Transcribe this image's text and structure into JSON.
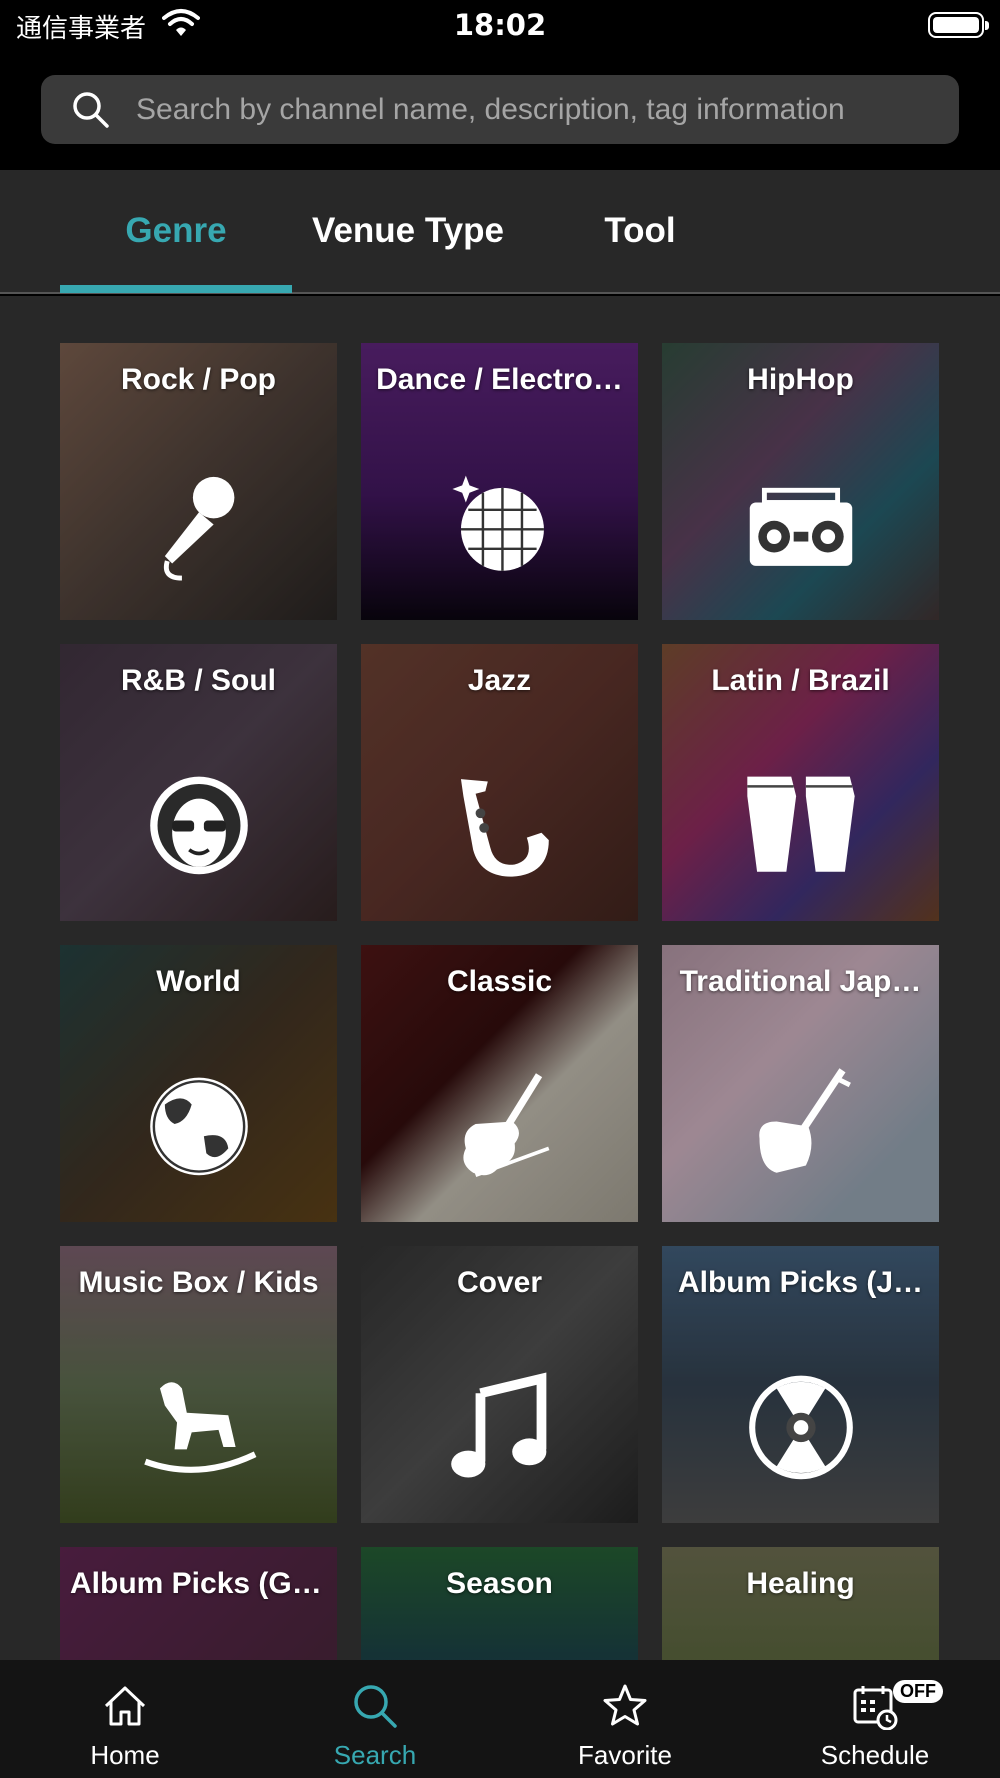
{
  "status_bar": {
    "carrier": "通信事業者",
    "time": "18:02"
  },
  "search": {
    "placeholder": "Search by channel name, description, tag information"
  },
  "tabs": [
    {
      "label": "Genre",
      "active": true
    },
    {
      "label": "Venue Type",
      "active": false
    },
    {
      "label": "Tool",
      "active": false
    }
  ],
  "genres": [
    {
      "label": "Rock / Pop",
      "icon": "microphone-icon"
    },
    {
      "label": "Dance / Electro…",
      "icon": "disco-ball-icon"
    },
    {
      "label": "HipHop",
      "icon": "boombox-icon"
    },
    {
      "label": "R&B / Soul",
      "icon": "afro-sunglasses-icon"
    },
    {
      "label": "Jazz",
      "icon": "saxophone-icon"
    },
    {
      "label": "Latin / Brazil",
      "icon": "conga-drums-icon"
    },
    {
      "label": "World",
      "icon": "globe-icon"
    },
    {
      "label": "Classic",
      "icon": "violin-icon"
    },
    {
      "label": "Traditional Jap…",
      "icon": "shamisen-icon"
    },
    {
      "label": "Music Box / Kids",
      "icon": "rocking-horse-icon"
    },
    {
      "label": "Cover",
      "icon": "music-note-icon"
    },
    {
      "label": "Album Picks (J…",
      "icon": "cd-disc-icon"
    },
    {
      "label": "Album Picks (Gl…",
      "icon": ""
    },
    {
      "label": "Season",
      "icon": ""
    },
    {
      "label": "Healing",
      "icon": ""
    }
  ],
  "bottom_nav": {
    "home": "Home",
    "search": "Search",
    "favorite": "Favorite",
    "schedule": "Schedule",
    "schedule_badge": "OFF"
  },
  "colors": {
    "accent": "#37a8b1",
    "background": "#282828",
    "nav_background": "#141414"
  }
}
